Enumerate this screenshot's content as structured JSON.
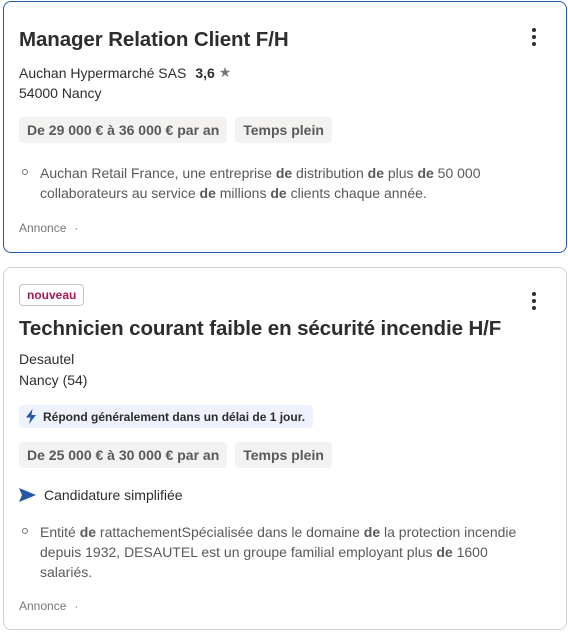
{
  "jobs": [
    {
      "title": "Manager Relation Client F/H",
      "company": "Auchan Hypermarché SAS",
      "rating": "3,6",
      "star": "★",
      "location": "54000 Nancy",
      "tags": [
        "De 29 000 € à 36 000 € par an",
        "Temps plein"
      ],
      "snippet": {
        "line1": [
          "Auchan Retail France, une entreprise ",
          "de",
          " distribution ",
          "de",
          " plus ",
          "de",
          " 50 000"
        ],
        "line2": [
          "collaborateurs au service ",
          "de",
          " millions ",
          "de",
          " clients chaque année."
        ]
      },
      "footer": "Annonce",
      "footer_sep": "·"
    },
    {
      "badge": "nouveau",
      "title": "Technicien courant faible en sécurité incendie H/F",
      "company": "Desautel",
      "location": "Nancy (54)",
      "respond": "Répond généralement dans un délai de 1 jour.",
      "tags": [
        "De 25 000 € à 30 000 € par an",
        "Temps plein"
      ],
      "easy_apply": "Candidature simplifiée",
      "snippet": {
        "line1": [
          "Entité ",
          "de",
          " rattachementSpécialisée dans le domaine ",
          "de",
          " la protection incendie"
        ],
        "line2": [
          "depuis 1932, DESAUTEL est un groupe familial employant plus ",
          "de",
          " 1600"
        ],
        "line3": [
          "salariés."
        ]
      },
      "footer": "Annonce",
      "footer_sep": "·"
    }
  ],
  "colors": {
    "accent_border": "#2557a7",
    "new_badge": "#a4195a",
    "respond_bg": "#eef1fe",
    "lightning": "#2557a7"
  }
}
